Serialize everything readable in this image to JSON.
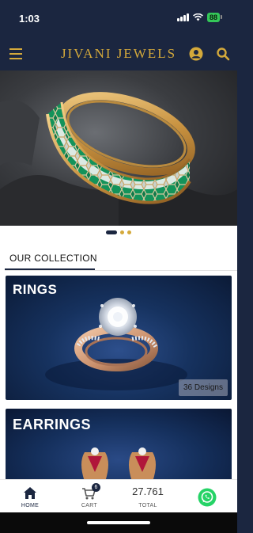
{
  "status_bar": {
    "time": "1:03",
    "battery": "88"
  },
  "header": {
    "brand": "JIVANI JEWELS",
    "icons": [
      "menu-icon",
      "user-icon",
      "search-icon"
    ]
  },
  "hero": {
    "image": "emerald-diamond-bangle",
    "slide_count": 3,
    "active_slide": 1
  },
  "collection": {
    "title": "OUR COLLECTION",
    "cards": [
      {
        "title": "RINGS",
        "designs": "36 Designs"
      },
      {
        "title": "EARRINGS"
      }
    ]
  },
  "bottom_nav": {
    "home": "HOME",
    "cart": "CART",
    "cart_count": "6",
    "total_value": "27.761",
    "total": "TOTAL"
  },
  "colors": {
    "navy": "#1b2640",
    "gold": "#d4a93b",
    "whatsapp": "#25d366"
  }
}
